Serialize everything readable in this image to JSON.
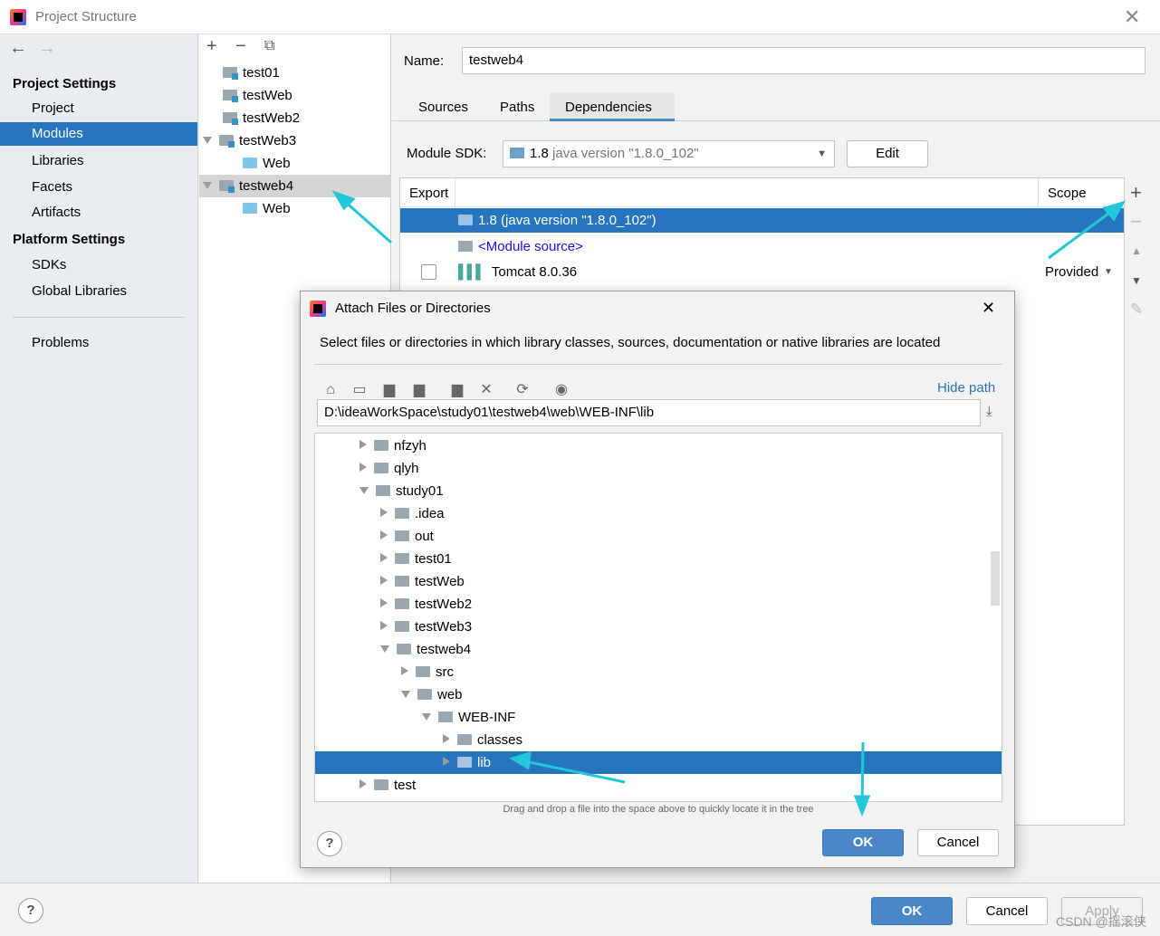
{
  "window": {
    "title": "Project Structure"
  },
  "nav": {
    "project_settings": "Project Settings",
    "platform_settings": "Platform Settings",
    "items": [
      {
        "label": "Project"
      },
      {
        "label": "Modules"
      },
      {
        "label": "Libraries"
      },
      {
        "label": "Facets"
      },
      {
        "label": "Artifacts"
      }
    ],
    "platform_items": [
      {
        "label": "SDKs"
      },
      {
        "label": "Global Libraries"
      }
    ],
    "problems": "Problems"
  },
  "modules": [
    {
      "label": "test01"
    },
    {
      "label": "testWeb"
    },
    {
      "label": "testWeb2"
    },
    {
      "label": "testWeb3"
    },
    {
      "label": "Web"
    },
    {
      "label": "testweb4"
    },
    {
      "label": "Web"
    }
  ],
  "module": {
    "name_label": "Name:",
    "name_value": "testweb4",
    "tabs": [
      {
        "label": "Sources"
      },
      {
        "label": "Paths"
      },
      {
        "label": "Dependencies"
      }
    ],
    "sdk_label": "Module SDK:",
    "sdk_version": "1.8",
    "sdk_detail": "java version \"1.8.0_102\"",
    "edit": "Edit",
    "columns": {
      "export": "Export",
      "scope": "Scope"
    },
    "deps": [
      {
        "label": "1.8 (java version \"1.8.0_102\")"
      },
      {
        "label": "<Module source>"
      },
      {
        "label": "Tomcat 8.0.36",
        "scope": "Provided"
      }
    ]
  },
  "dialog": {
    "title": "Attach Files or Directories",
    "description": "Select files or directories in which library classes, sources, documentation or native libraries are located",
    "hide_path": "Hide path",
    "path": "D:\\ideaWorkSpace\\study01\\testweb4\\web\\WEB-INF\\lib",
    "tree": [
      {
        "label": "nfzyh",
        "level": 0,
        "expanded": false
      },
      {
        "label": "qlyh",
        "level": 0,
        "expanded": false
      },
      {
        "label": "study01",
        "level": 0,
        "expanded": true
      },
      {
        "label": ".idea",
        "level": 1,
        "expanded": false
      },
      {
        "label": "out",
        "level": 1,
        "expanded": false
      },
      {
        "label": "test01",
        "level": 1,
        "expanded": false
      },
      {
        "label": "testWeb",
        "level": 1,
        "expanded": false
      },
      {
        "label": "testWeb2",
        "level": 1,
        "expanded": false
      },
      {
        "label": "testWeb3",
        "level": 1,
        "expanded": false
      },
      {
        "label": "testweb4",
        "level": 1,
        "expanded": true
      },
      {
        "label": "src",
        "level": 2,
        "expanded": false
      },
      {
        "label": "web",
        "level": 2,
        "expanded": true
      },
      {
        "label": "WEB-INF",
        "level": 3,
        "expanded": true
      },
      {
        "label": "classes",
        "level": 4,
        "expanded": false
      },
      {
        "label": "lib",
        "level": 4,
        "expanded": false,
        "selected": true
      },
      {
        "label": "test",
        "level": 0,
        "expanded": false
      }
    ],
    "hint": "Drag and drop a file into the space above to quickly locate it in the tree",
    "ok": "OK",
    "cancel": "Cancel"
  },
  "footer": {
    "ok": "OK",
    "cancel": "Cancel",
    "apply": "Apply",
    "watermark": "CSDN @摇滚侠"
  },
  "colors": {
    "selection": "#2675bf",
    "accent": "#4a87c8",
    "annotation": "#22c8d8"
  }
}
